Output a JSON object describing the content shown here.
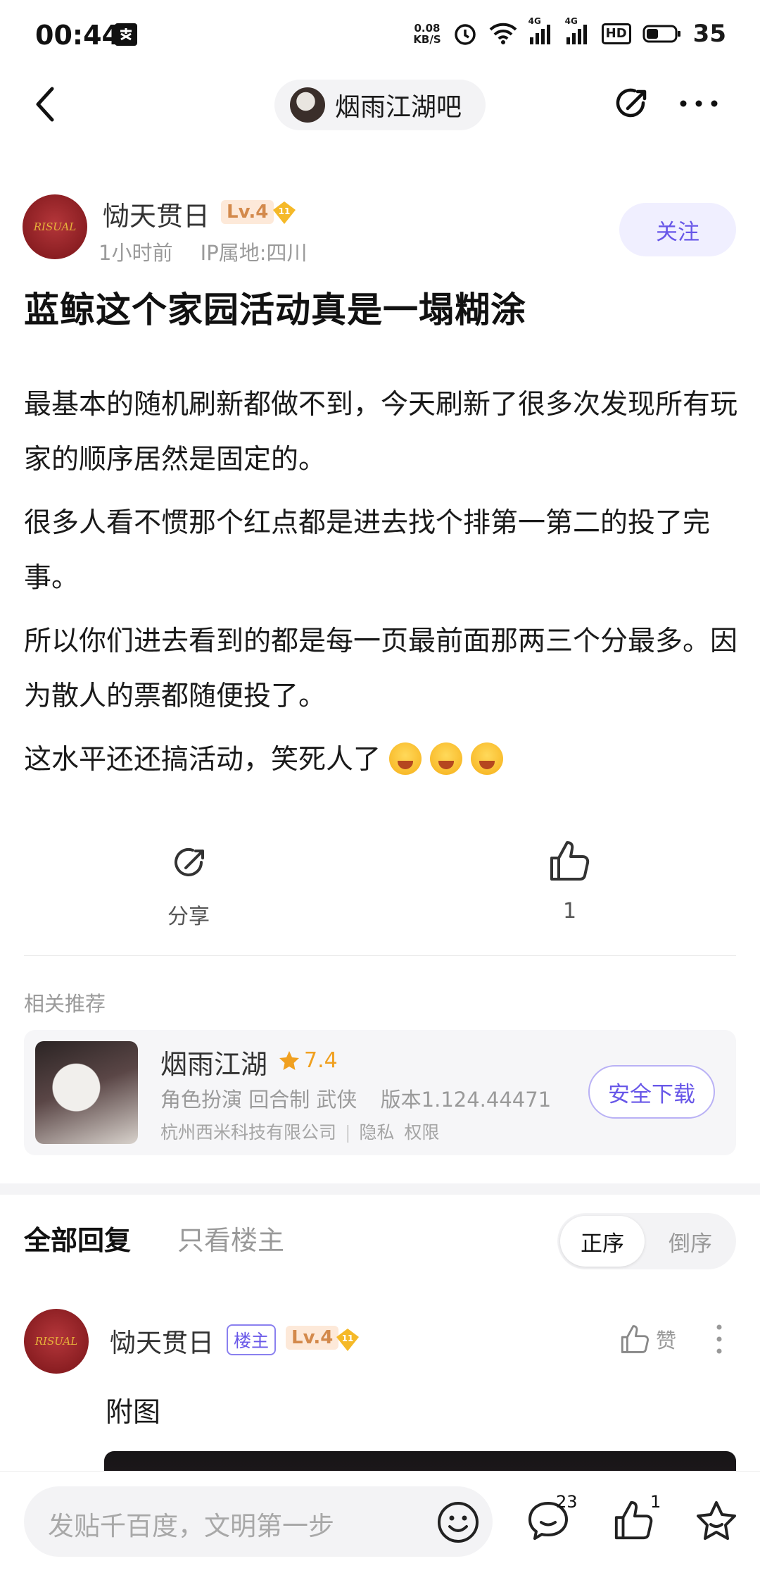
{
  "status_bar": {
    "time": "00:44",
    "net_speed_top": "0.08",
    "net_speed_bottom": "KB/S",
    "signal_1": "4G",
    "signal_2": "4G",
    "hd": "HD",
    "battery": "35"
  },
  "nav": {
    "forum_name": "烟雨江湖吧"
  },
  "post": {
    "author_name": "恸天贯日",
    "author_level": "Lv.4",
    "badge_number": "11",
    "avatar_text": "RISUAL",
    "time": "1小时前",
    "ip_location": "IP属地:四川",
    "follow_label": "关注",
    "title": "蓝鲸这个家园活动真是一塌糊涂",
    "paragraphs": [
      "最基本的随机刷新都做不到，今天刷新了很多次发现所有玩家的顺序居然是固定的。",
      "很多人看不惯那个红点都是进去找个排第一第二的投了完事。",
      "所以你们进去看到的都是每一页最前面那两三个分最多。因为散人的票都随便投了。",
      "这水平还还搞活动，笑死人了"
    ],
    "emoji_name": "laughing-emoji",
    "share_label": "分享",
    "like_count": "1"
  },
  "recommend": {
    "section_title": "相关推荐",
    "app_name": "烟雨江湖",
    "rating": "7.4",
    "tags": "角色扮演 回合制 武侠",
    "version": "版本1.124.44471",
    "developer": "杭州西米科技有限公司",
    "privacy": "隐私",
    "permission": "权限",
    "download_label": "安全下载"
  },
  "comments": {
    "tab_all": "全部回复",
    "tab_host_only": "只看楼主",
    "sort_asc": "正序",
    "sort_desc": "倒序",
    "items": [
      {
        "author_name": "恸天贯日",
        "host_tag": "楼主",
        "level": "Lv.4",
        "badge_number": "11",
        "like_label": "赞",
        "text": "附图"
      }
    ]
  },
  "bottom_bar": {
    "reply_placeholder": "发贴千百度，文明第一步",
    "comment_count": "23",
    "like_count": "1"
  },
  "colors": {
    "accent": "#6857e8",
    "level_bg": "#fde9d9",
    "level_text": "#d3894b",
    "rating": "#f0a020"
  }
}
